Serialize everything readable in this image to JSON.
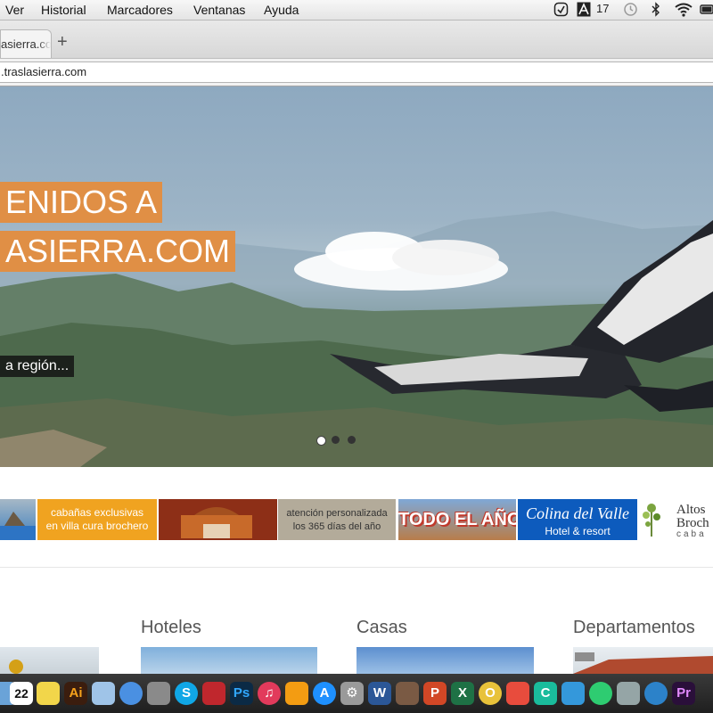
{
  "menubar": {
    "items": [
      "Ver",
      "Historial",
      "Marcadores",
      "Ventanas",
      "Ayuda"
    ],
    "status_count": "17"
  },
  "browser": {
    "tab_title": "asierra.co",
    "new_tab_label": "+",
    "url": ".traslasierra.com"
  },
  "hero": {
    "title_line1": "ENIDOS A",
    "title_line2": "ASIERRA.COM",
    "subtitle": "a región...",
    "slides": 3,
    "active_slide": 1
  },
  "banners": [
    {
      "text": ""
    },
    {
      "text_line1": "cabañas exclusivas",
      "text_line2": "en villa cura brochero"
    },
    {
      "text": ""
    },
    {
      "text_line1": "atención personalizada",
      "text_line2": "los 365 días del año"
    },
    {
      "text": "TODO EL AÑO"
    },
    {
      "text_line1": "Colina del Valle",
      "text_line2": "Hotel & resort"
    },
    {
      "text_line1": "Altos",
      "text_line2": "Broch",
      "text_line3": "caba"
    }
  ],
  "categories": [
    "Hoteles",
    "Casas",
    "Departamentos"
  ],
  "dock": {
    "calendar_day": "22",
    "icons": [
      "finder-icon",
      "calendar-icon",
      "stickies-icon",
      "illustrator-icon",
      "preview-icon",
      "messages-icon",
      "facetime-icon",
      "skype-icon",
      "photo-booth-icon",
      "photoshop-icon",
      "itunes-icon",
      "ibooks-icon",
      "app-store-icon",
      "system-preferences-icon",
      "word-icon",
      "keynote-icon",
      "powerpoint-icon",
      "excel-icon",
      "opera-icon",
      "popcorn-icon",
      "cocoa-icon",
      "c-app-icon",
      "network-icon",
      "satellite-icon",
      "quicktime-icon",
      "premiere-icon"
    ]
  }
}
